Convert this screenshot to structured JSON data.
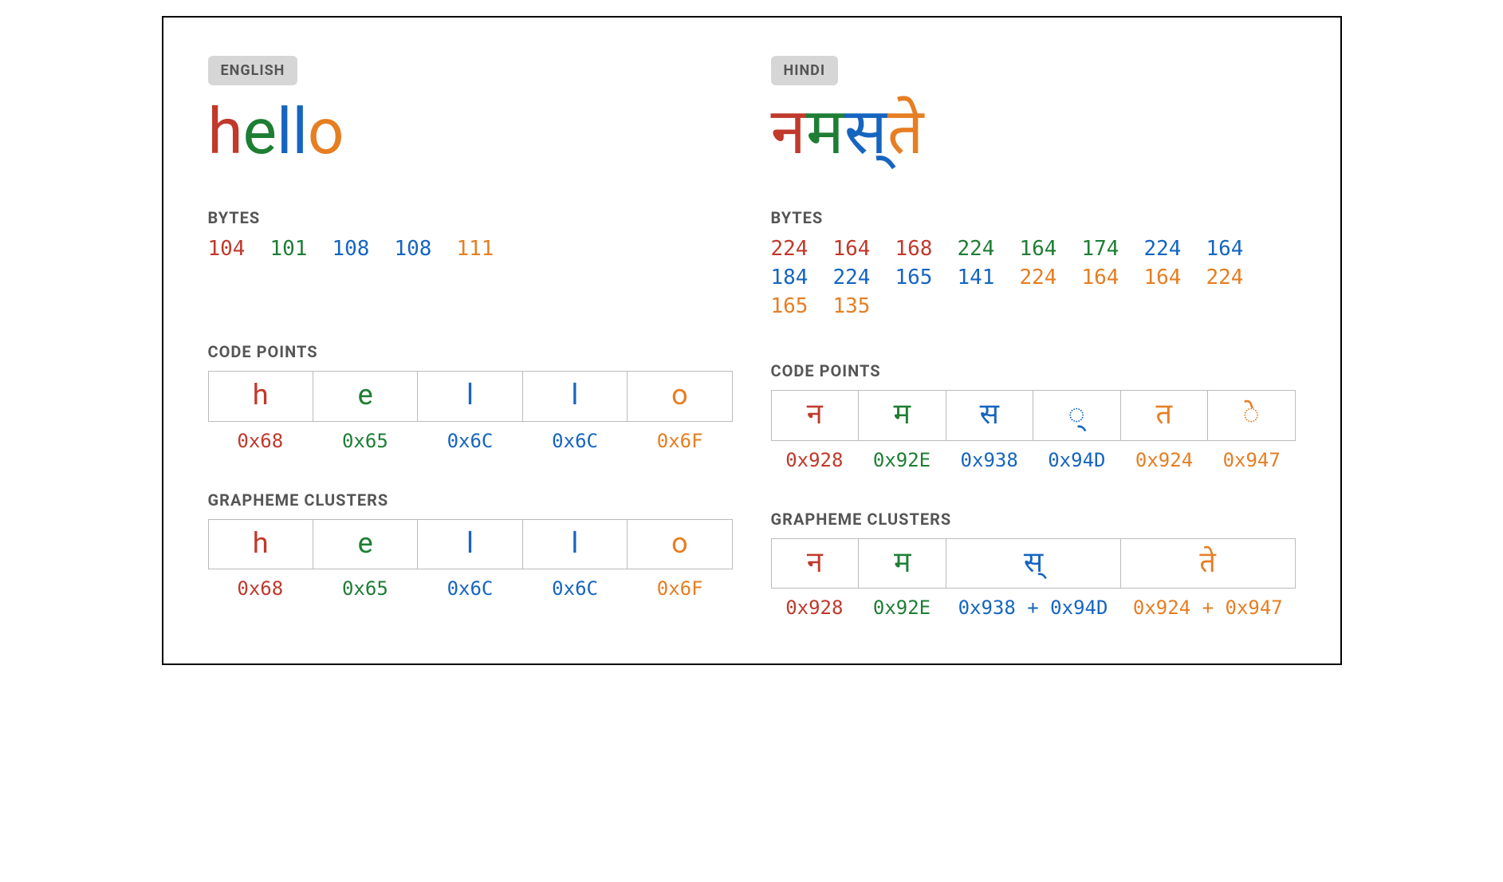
{
  "labels": {
    "bytes": "BYTES",
    "codepoints": "CODE POINTS",
    "graphemes": "GRAPHEME CLUSTERS"
  },
  "colors": {
    "red": "#c0392b",
    "green": "#1e7e34",
    "blue": "#1565c0",
    "orange": "#e67e22"
  },
  "columns": [
    {
      "lang_label": "ENGLISH",
      "headline_chars": [
        {
          "text": "h",
          "color": "red"
        },
        {
          "text": "e",
          "color": "green"
        },
        {
          "text": "l",
          "color": "blue"
        },
        {
          "text": "l",
          "color": "blue"
        },
        {
          "text": "o",
          "color": "orange"
        }
      ],
      "bytes": [
        {
          "v": "104",
          "color": "red"
        },
        {
          "v": "101",
          "color": "green"
        },
        {
          "v": "108",
          "color": "blue"
        },
        {
          "v": "108",
          "color": "blue"
        },
        {
          "v": "111",
          "color": "orange"
        }
      ],
      "codepoints": [
        {
          "glyph": "h",
          "hex": "0x68",
          "color": "red"
        },
        {
          "glyph": "e",
          "hex": "0x65",
          "color": "green"
        },
        {
          "glyph": "l",
          "hex": "0x6C",
          "color": "blue"
        },
        {
          "glyph": "l",
          "hex": "0x6C",
          "color": "blue"
        },
        {
          "glyph": "o",
          "hex": "0x6F",
          "color": "orange"
        }
      ],
      "graphemes": [
        {
          "glyph": "h",
          "hex": "0x68",
          "color": "red",
          "span": 1
        },
        {
          "glyph": "e",
          "hex": "0x65",
          "color": "green",
          "span": 1
        },
        {
          "glyph": "l",
          "hex": "0x6C",
          "color": "blue",
          "span": 1
        },
        {
          "glyph": "l",
          "hex": "0x6C",
          "color": "blue",
          "span": 1
        },
        {
          "glyph": "o",
          "hex": "0x6F",
          "color": "orange",
          "span": 1
        }
      ],
      "grapheme_span_total": 5
    },
    {
      "lang_label": "HINDI",
      "headline_chars": [
        {
          "text": "न",
          "color": "red"
        },
        {
          "text": "म",
          "color": "green"
        },
        {
          "text": "स्",
          "color": "blue"
        },
        {
          "text": "ते",
          "color": "orange"
        }
      ],
      "bytes": [
        {
          "v": "224",
          "color": "red"
        },
        {
          "v": "164",
          "color": "red"
        },
        {
          "v": "168",
          "color": "red"
        },
        {
          "v": "224",
          "color": "green"
        },
        {
          "v": "164",
          "color": "green"
        },
        {
          "v": "174",
          "color": "green"
        },
        {
          "v": "224",
          "color": "blue"
        },
        {
          "v": "164",
          "color": "blue"
        },
        {
          "v": "184",
          "color": "blue"
        },
        {
          "v": "224",
          "color": "blue"
        },
        {
          "v": "165",
          "color": "blue"
        },
        {
          "v": "141",
          "color": "blue"
        },
        {
          "v": "224",
          "color": "orange"
        },
        {
          "v": "164",
          "color": "orange"
        },
        {
          "v": "164",
          "color": "orange"
        },
        {
          "v": "224",
          "color": "orange"
        },
        {
          "v": "165",
          "color": "orange"
        },
        {
          "v": "135",
          "color": "orange"
        }
      ],
      "codepoints": [
        {
          "glyph": "न",
          "hex": "0x928",
          "color": "red"
        },
        {
          "glyph": "म",
          "hex": "0x92E",
          "color": "green"
        },
        {
          "glyph": "स",
          "hex": "0x938",
          "color": "blue"
        },
        {
          "glyph": "◌्",
          "hex": "0x94D",
          "color": "blue"
        },
        {
          "glyph": "त",
          "hex": "0x924",
          "color": "orange"
        },
        {
          "glyph": "◌े",
          "hex": "0x947",
          "color": "orange"
        }
      ],
      "graphemes": [
        {
          "glyph": "न",
          "hex": "0x928",
          "color": "red",
          "span": 1
        },
        {
          "glyph": "म",
          "hex": "0x92E",
          "color": "green",
          "span": 1
        },
        {
          "glyph": "स्",
          "hex": "0x938 + 0x94D",
          "color": "blue",
          "span": 2
        },
        {
          "glyph": "ते",
          "hex": "0x924 + 0x947",
          "color": "orange",
          "span": 2
        }
      ],
      "grapheme_span_total": 6
    }
  ]
}
